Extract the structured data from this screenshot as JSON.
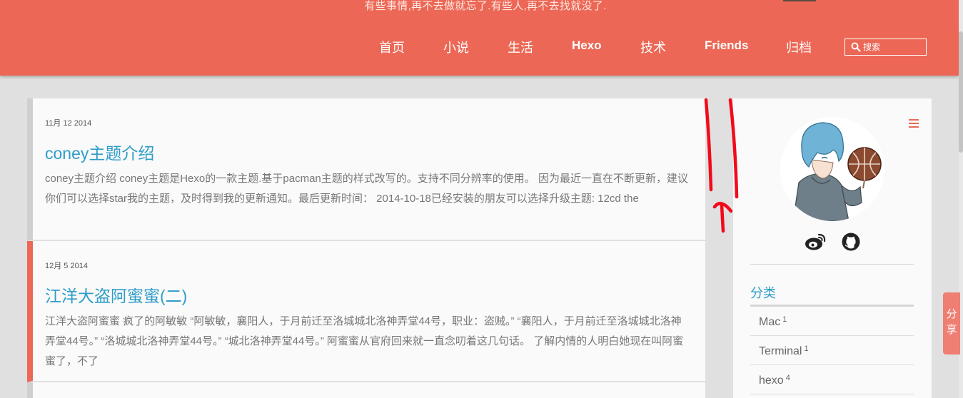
{
  "header": {
    "tagline": "有些事情,再不去做就忘了.有些人,再不去找就没了.",
    "nav": [
      {
        "label": "首页"
      },
      {
        "label": "小说"
      },
      {
        "label": "生活"
      },
      {
        "label": "Hexo"
      },
      {
        "label": "技术"
      },
      {
        "label": "Friends"
      },
      {
        "label": "归档"
      }
    ],
    "search": {
      "placeholder": "搜索",
      "value": "",
      "icon": "search-icon"
    }
  },
  "posts": [
    {
      "date": "11月 12 2014",
      "title": "coney主题介绍",
      "excerpt": "coney主题介绍 coney主题是Hexo的一款主题.基于pacman主题的样式改写的。支持不同分辨率的使用。 因为最近一直在不断更新，建议你们可以选择star我的主题，及时得到我的更新通知。最后更新时间： 2014-10-18已经安装的朋友可以选择升级主题: 12cd the"
    },
    {
      "date": "12月 5 2014",
      "title": "江洋大盗阿蜜蜜(二)",
      "excerpt": "江洋大盗阿蜜蜜 疯了的阿敏敏 “阿敏敏，襄阳人，于月前迁至洛城城北洛神弄堂44号，职业：盗贼。” “襄阳人，于月前迁至洛城城北洛神弄堂44号。” “洛城城北洛神弄堂44号。” “城北洛神弄堂44号。” 阿蜜蜜从官府回来就一直念叨着这几句话。 了解内情的人明白她现在叫阿蜜蜜了，不了"
    }
  ],
  "sidebar": {
    "menu_icon": "menu-icon",
    "social": [
      {
        "icon": "weibo-icon"
      },
      {
        "icon": "github-icon"
      }
    ],
    "categories_heading": "分类",
    "categories": [
      {
        "name": "Mac",
        "count": "1"
      },
      {
        "name": "Terminal",
        "count": "1"
      },
      {
        "name": "hexo",
        "count": "4"
      }
    ]
  },
  "share": {
    "label": "分享"
  },
  "colors": {
    "brand": "#ec6755",
    "link": "#2e9dc8",
    "background": "#e0e0e0"
  }
}
